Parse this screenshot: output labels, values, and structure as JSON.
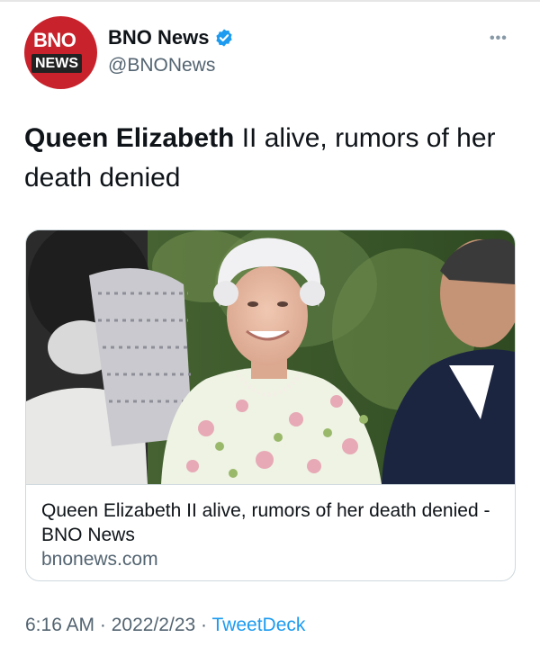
{
  "tweet": {
    "author": {
      "display_name": "BNO News",
      "handle": "@BNONews",
      "verified": true,
      "avatar_logo_text": "BNO",
      "avatar_logo_sub": "NEWS"
    },
    "text_bold": "Queen Elizabeth",
    "text_rest": " II alive, rumors of her death denied",
    "card": {
      "title": "Queen Elizabeth II alive, rumors of her death denied - BNO News",
      "domain": "bnonews.com"
    },
    "time": "6:16 AM",
    "separator": "·",
    "date": "2022/2/23",
    "source": "TweetDeck",
    "more_glyph": "•••"
  },
  "colors": {
    "brand_red": "#c8232c",
    "link_blue": "#1d9bf0",
    "secondary_text": "#536471"
  }
}
